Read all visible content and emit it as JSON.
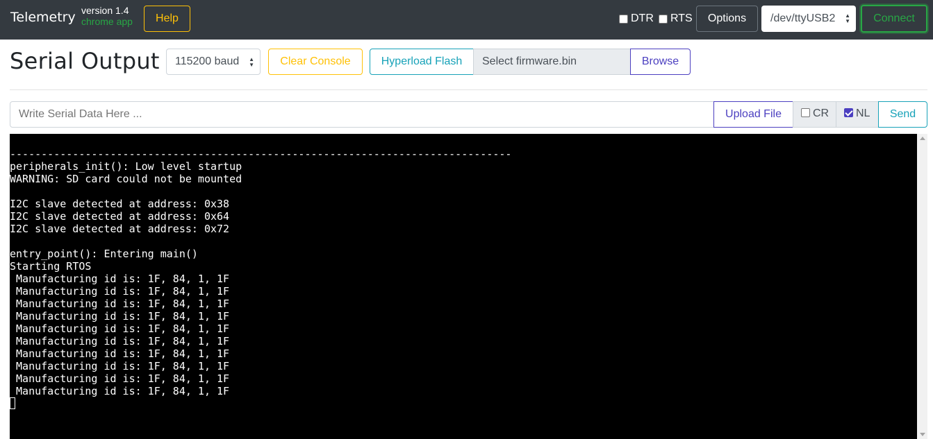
{
  "navbar": {
    "brand": "Telemetry",
    "version": "version 1.4",
    "subtitle": "chrome app",
    "help_label": "Help",
    "dtr_label": "DTR",
    "rts_label": "RTS",
    "options_label": "Options",
    "port_selected": "/dev/ttyUSB2",
    "connect_label": "Connect",
    "dtr_checked": false,
    "rts_checked": false
  },
  "toolbar": {
    "title": "Serial Output",
    "baud_selected": "115200 baud",
    "clear_label": "Clear Console",
    "hyperload_label": "Hyperload Flash",
    "firmware_placeholder": "Select firmware.bin",
    "browse_label": "Browse"
  },
  "input_row": {
    "placeholder": "Write Serial Data Here ...",
    "upload_label": "Upload File",
    "cr_label": "CR",
    "cr_checked": false,
    "nl_label": "NL",
    "nl_checked": true,
    "send_label": "Send"
  },
  "console": {
    "lines": [
      "--------------------------------------------------------------------------------",
      "peripherals_init(): Low level startup",
      "WARNING: SD card could not be mounted",
      "",
      "I2C slave detected at address: 0x38",
      "I2C slave detected at address: 0x64",
      "I2C slave detected at address: 0x72",
      "",
      "entry_point(): Entering main()",
      "Starting RTOS",
      " Manufacturing id is: 1F, 84, 1, 1F",
      " Manufacturing id is: 1F, 84, 1, 1F",
      " Manufacturing id is: 1F, 84, 1, 1F",
      " Manufacturing id is: 1F, 84, 1, 1F",
      " Manufacturing id is: 1F, 84, 1, 1F",
      " Manufacturing id is: 1F, 84, 1, 1F",
      " Manufacturing id is: 1F, 84, 1, 1F",
      " Manufacturing id is: 1F, 84, 1, 1F",
      " Manufacturing id is: 1F, 84, 1, 1F",
      " Manufacturing id is: 1F, 84, 1, 1F"
    ]
  },
  "colors": {
    "navbar_bg": "#343a40",
    "warning": "#ffc107",
    "success": "#28a745",
    "info": "#17a2b8",
    "primary": "#4b3fc0",
    "console_bg": "#000000"
  },
  "icons": {
    "select_arrows": "updown-arrows-icon",
    "checkbox": "checkbox-icon",
    "cursor": "text-cursor-icon"
  }
}
